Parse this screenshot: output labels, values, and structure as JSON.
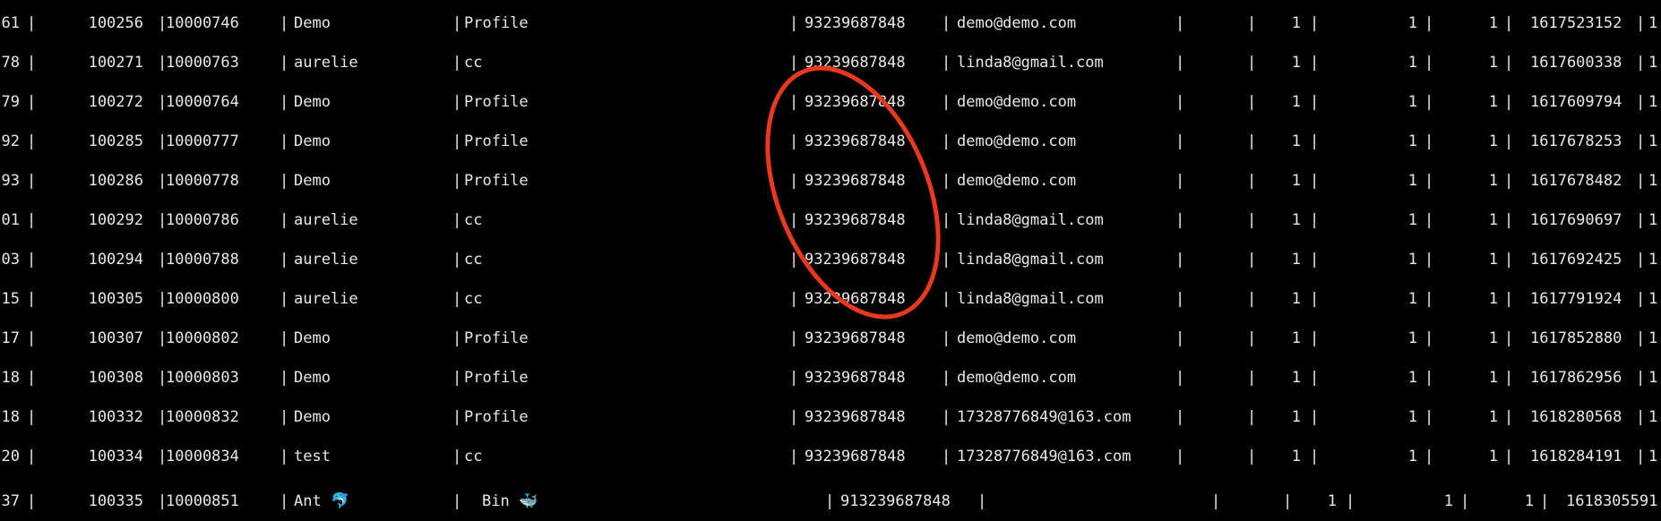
{
  "terminal": {
    "rows": [
      [
        "61",
        "100256",
        "10000746",
        "Demo",
        "Profile",
        "93239687848",
        "demo@demo.com",
        "1",
        "1",
        "1",
        "1617523152",
        "1"
      ],
      [
        "78",
        "100271",
        "10000763",
        "aurelie",
        "cc",
        "93239687848",
        "linda8@gmail.com",
        "1",
        "1",
        "1",
        "1617600338",
        "1"
      ],
      [
        "79",
        "100272",
        "10000764",
        "Demo",
        "Profile",
        "93239687848",
        "demo@demo.com",
        "1",
        "1",
        "1",
        "1617609794",
        "1"
      ],
      [
        "92",
        "100285",
        "10000777",
        "Demo",
        "Profile",
        "93239687848",
        "demo@demo.com",
        "1",
        "1",
        "1",
        "1617678253",
        "1"
      ],
      [
        "93",
        "100286",
        "10000778",
        "Demo",
        "Profile",
        "93239687848",
        "demo@demo.com",
        "1",
        "1",
        "1",
        "1617678482",
        "1"
      ],
      [
        "01",
        "100292",
        "10000786",
        "aurelie",
        "cc",
        "93239687848",
        "linda8@gmail.com",
        "1",
        "1",
        "1",
        "1617690697",
        "1"
      ],
      [
        "03",
        "100294",
        "10000788",
        "aurelie",
        "cc",
        "93239687848",
        "linda8@gmail.com",
        "1",
        "1",
        "1",
        "1617692425",
        "1"
      ],
      [
        "15",
        "100305",
        "10000800",
        "aurelie",
        "cc",
        "93239687848",
        "linda8@gmail.com",
        "1",
        "1",
        "1",
        "1617791924",
        "1"
      ],
      [
        "17",
        "100307",
        "10000802",
        "Demo",
        "Profile",
        "93239687848",
        "demo@demo.com",
        "1",
        "1",
        "1",
        "1617852880",
        "1"
      ],
      [
        "18",
        "100308",
        "10000803",
        "Demo",
        "Profile",
        "93239687848",
        "demo@demo.com",
        "1",
        "1",
        "1",
        "1617862956",
        "1"
      ],
      [
        "18",
        "100332",
        "10000832",
        "Demo",
        "Profile",
        "93239687848",
        "17328776849@163.com",
        "1",
        "1",
        "1",
        "1618280568",
        "1"
      ],
      [
        "20",
        "100334",
        "10000834",
        "test",
        "cc",
        "93239687848",
        "17328776849@163.com",
        "1",
        "1",
        "1",
        "1618284191",
        "1"
      ],
      [
        "37",
        "100335",
        "10000851",
        "Ant 🐬",
        "Bin 🐳",
        "913239687848",
        "",
        "1",
        "1",
        "1",
        "1618305591",
        ""
      ]
    ]
  },
  "annotation": {
    "color": "#e8391f",
    "shape": "ellipse"
  }
}
